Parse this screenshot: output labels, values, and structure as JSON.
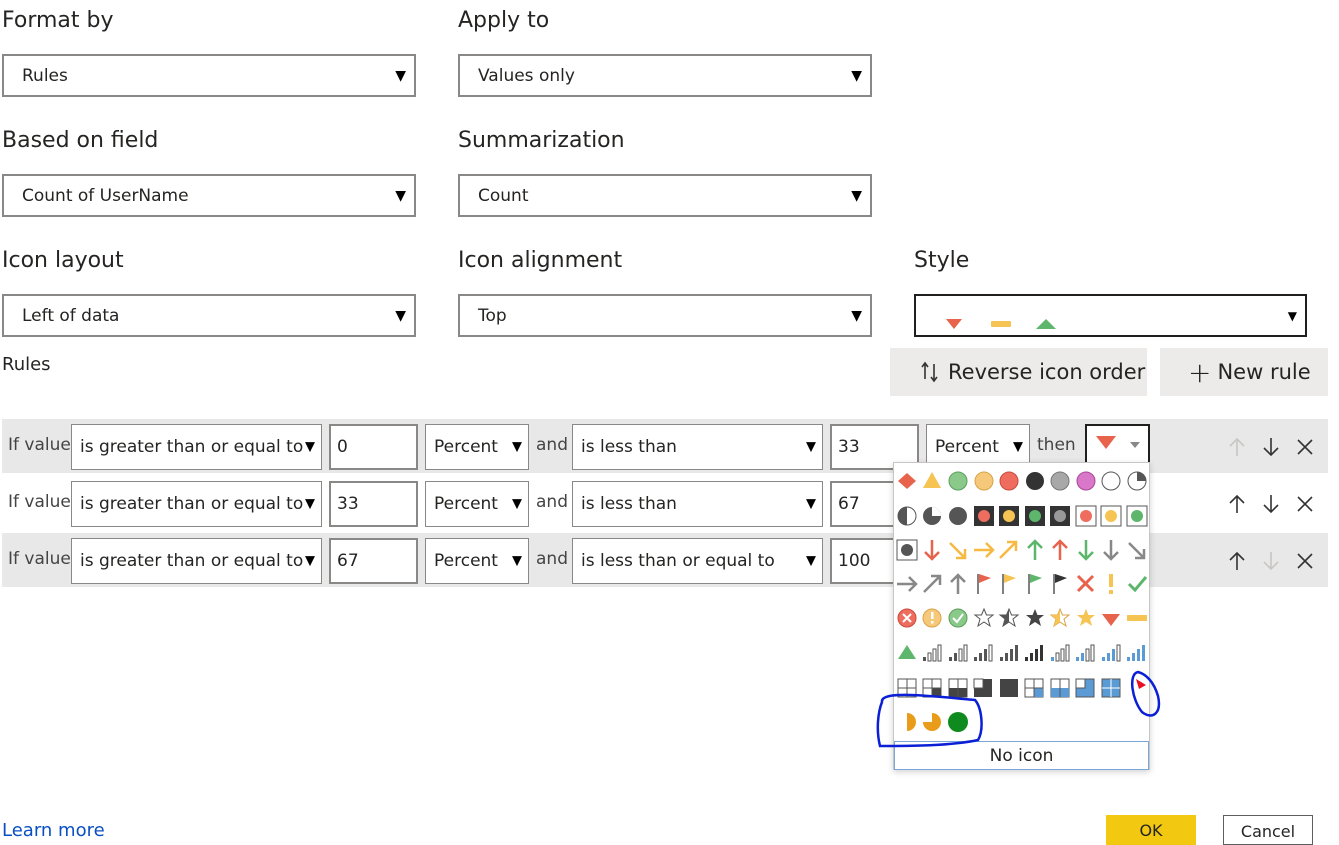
{
  "format_by": {
    "label": "Format by",
    "value": "Rules"
  },
  "apply_to": {
    "label": "Apply to",
    "value": "Values only"
  },
  "based_on_field": {
    "label": "Based on field",
    "value": "Count of UserName"
  },
  "summarization": {
    "label": "Summarization",
    "value": "Count"
  },
  "icon_layout": {
    "label": "Icon layout",
    "value": "Left of data"
  },
  "icon_alignment": {
    "label": "Icon alignment",
    "value": "Top"
  },
  "style": {
    "label": "Style",
    "icons": [
      "red-down-triangle-icon",
      "yellow-dash-icon",
      "green-up-triangle-icon"
    ]
  },
  "rules_label": "Rules",
  "buttons": {
    "reverse": "Reverse icon order",
    "new_rule": "New rule"
  },
  "rules": [
    {
      "if": "If value",
      "op1": "is greater than or equal to",
      "v1": "0",
      "u1": "Percent",
      "and": "and",
      "op2": "is less than",
      "v2": "33",
      "u2": "Percent",
      "then": "then"
    },
    {
      "if": "If value",
      "op1": "is greater than or equal to",
      "v1": "33",
      "u1": "Percent",
      "and": "and",
      "op2": "is less than",
      "v2": "67"
    },
    {
      "if": "If value",
      "op1": "is greater than or equal to",
      "v1": "67",
      "u1": "Percent",
      "and": "and",
      "op2": "is less than or equal to",
      "v2": "100"
    }
  ],
  "icon_picker": {
    "no_icon": "No icon"
  },
  "footer": {
    "learn_more": "Learn more",
    "ok": "OK",
    "cancel": "Cancel"
  },
  "colors": {
    "red": "#e8634c",
    "yellow": "#f6c453",
    "green": "#5db66b",
    "annotation": "#0a1fd6",
    "ok": "#f2c811",
    "link": "#0a4fc4"
  }
}
